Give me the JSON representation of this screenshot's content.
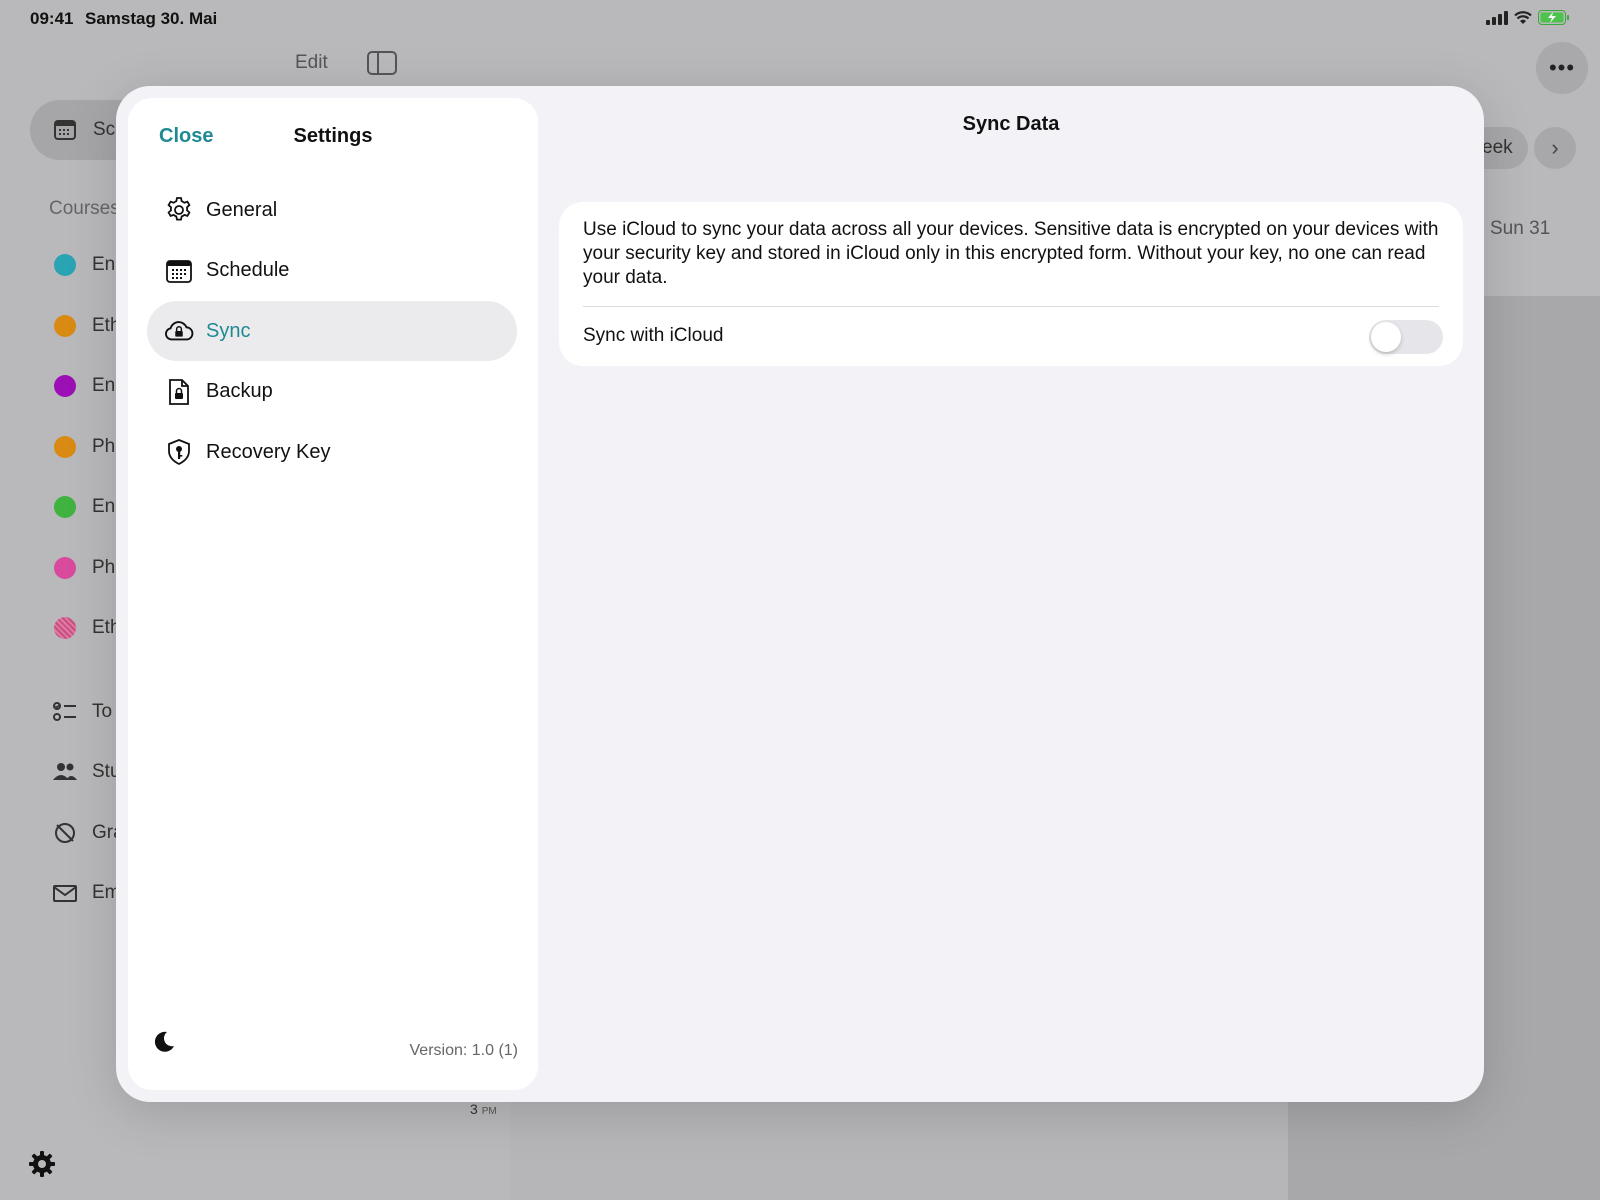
{
  "status_bar": {
    "time": "09:41",
    "date": "Samstag 30. Mai"
  },
  "background": {
    "edit_label": "Edit",
    "schedule_label": "Sc",
    "courses_label": "Courses",
    "courses": [
      {
        "label": "En",
        "color": "#2aa3b3"
      },
      {
        "label": "Eth",
        "color": "#d98a13"
      },
      {
        "label": "En",
        "color": "#9b0fb5"
      },
      {
        "label": "Ph",
        "color": "#d98a13"
      },
      {
        "label": "En",
        "color": "#3fb23f"
      },
      {
        "label": "Ph",
        "color": "#d94a9c"
      },
      {
        "label": "Eth",
        "color": "#c8507f"
      }
    ],
    "nav": [
      {
        "label": "To",
        "icon": "todo-list-icon"
      },
      {
        "label": "Stu",
        "icon": "students-icon"
      },
      {
        "label": "Gra",
        "icon": "grades-icon"
      },
      {
        "label": "Em",
        "icon": "mail-icon"
      }
    ],
    "week_label": "eek",
    "sun_label": "Sun 31",
    "hour_label": "3",
    "hour_suffix": "PM"
  },
  "settings": {
    "close_label": "Close",
    "title": "Settings",
    "menu": [
      {
        "label": "General",
        "icon": "gear-icon",
        "active": false
      },
      {
        "label": "Schedule",
        "icon": "calendar-icon",
        "active": false
      },
      {
        "label": "Sync",
        "icon": "cloud-lock-icon",
        "active": true
      },
      {
        "label": "Backup",
        "icon": "document-lock-icon",
        "active": false
      },
      {
        "label": "Recovery Key",
        "icon": "shield-key-icon",
        "active": false
      }
    ],
    "version": "Version: 1.0 (1)",
    "accent_color": "#1f8a94"
  },
  "detail": {
    "title": "Sync Data",
    "description": "Use iCloud to sync your data across all your devices. Sensitive data is encrypted on your devices with your security key and stored in iCloud only in this encrypted form. Without your key, no one can read your data.",
    "toggle_label": "Sync with iCloud",
    "toggle_on": false
  }
}
